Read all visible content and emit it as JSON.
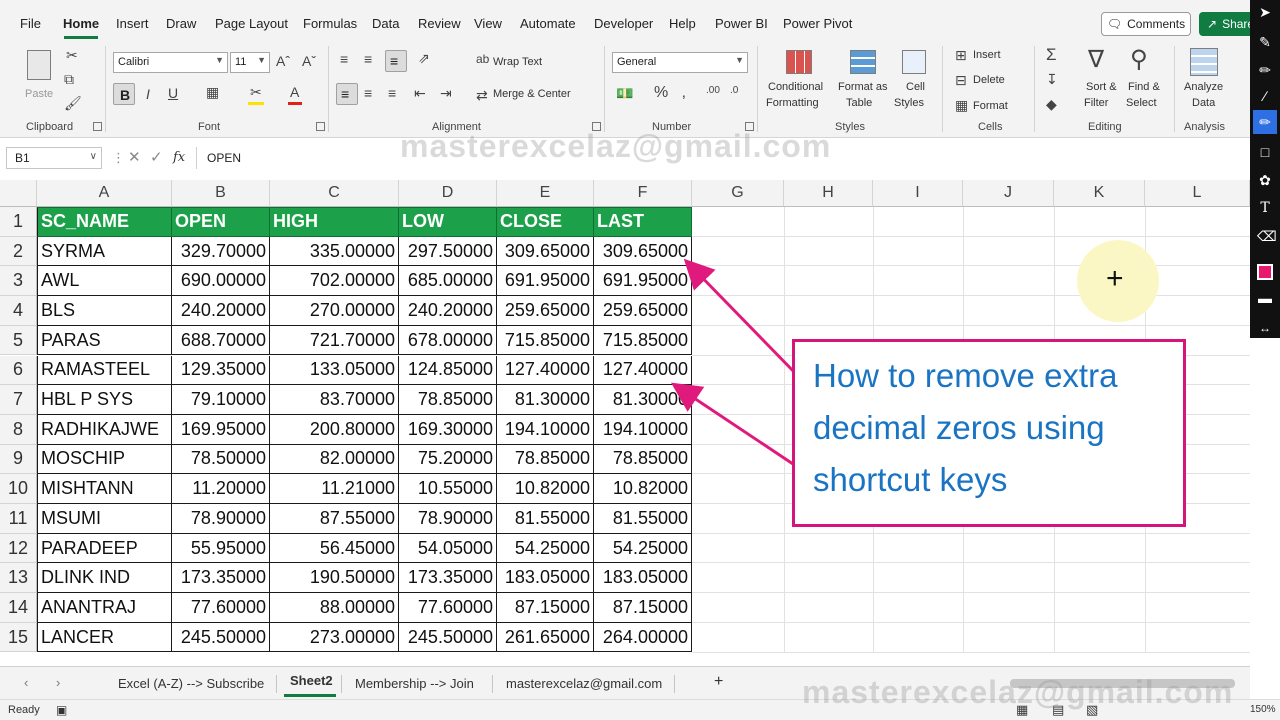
{
  "menu": {
    "items": [
      "File",
      "Home",
      "Insert",
      "Draw",
      "Page Layout",
      "Formulas",
      "Data",
      "Review",
      "View",
      "Automate",
      "Developer",
      "Help",
      "Power BI",
      "Power Pivot"
    ],
    "active": "Home",
    "comments_label": "Comments",
    "share_label": "Share"
  },
  "ribbon": {
    "clipboard": {
      "paste_label": "Paste",
      "group_label": "Clipboard"
    },
    "font": {
      "font_name": "Calibri",
      "font_size": "11",
      "group_label": "Font"
    },
    "alignment": {
      "wrap_text": "Wrap Text",
      "merge_center": "Merge & Center",
      "group_label": "Alignment"
    },
    "number": {
      "format": "General",
      "group_label": "Number"
    },
    "styles": {
      "conditional_1": "Conditional",
      "conditional_2": "Formatting",
      "format_as_1": "Format as",
      "format_as_2": "Table",
      "cell_styles_1": "Cell",
      "cell_styles_2": "Styles",
      "group_label": "Styles"
    },
    "cells": {
      "insert": "Insert",
      "delete": "Delete",
      "format": "Format",
      "group_label": "Cells"
    },
    "editing": {
      "sort_1": "Sort &",
      "sort_2": "Filter",
      "find_1": "Find &",
      "find_2": "Select",
      "group_label": "Editing"
    },
    "analysis": {
      "analyze_1": "Analyze",
      "analyze_2": "Data",
      "group_label": "Analysis"
    }
  },
  "formula_bar": {
    "name_box": "B1",
    "fx": "fx",
    "value": "OPEN"
  },
  "columns": [
    "A",
    "B",
    "C",
    "D",
    "E",
    "F",
    "G",
    "H",
    "I",
    "J",
    "K",
    "L"
  ],
  "rows": [
    "1",
    "2",
    "3",
    "4",
    "5",
    "6",
    "7",
    "8",
    "9",
    "10",
    "11",
    "12",
    "13",
    "14",
    "15"
  ],
  "table": {
    "headers": [
      "SC_NAME",
      "OPEN",
      "HIGH",
      "LOW",
      "CLOSE",
      "LAST"
    ],
    "rows": [
      [
        "SYRMA",
        "329.70000",
        "335.00000",
        "297.50000",
        "309.65000",
        "309.65000"
      ],
      [
        "AWL",
        "690.00000",
        "702.00000",
        "685.00000",
        "691.95000",
        "691.95000"
      ],
      [
        "BLS",
        "240.20000",
        "270.00000",
        "240.20000",
        "259.65000",
        "259.65000"
      ],
      [
        "PARAS",
        "688.70000",
        "721.70000",
        "678.00000",
        "715.85000",
        "715.85000"
      ],
      [
        "RAMASTEEL",
        "129.35000",
        "133.05000",
        "124.85000",
        "127.40000",
        "127.40000"
      ],
      [
        "HBL P SYS",
        "79.10000",
        "83.70000",
        "78.85000",
        "81.30000",
        "81.30000"
      ],
      [
        "RADHIKAJWE",
        "169.95000",
        "200.80000",
        "169.30000",
        "194.10000",
        "194.10000"
      ],
      [
        "MOSCHIP",
        "78.50000",
        "82.00000",
        "75.20000",
        "78.85000",
        "78.85000"
      ],
      [
        "MISHTANN",
        "11.20000",
        "11.21000",
        "10.55000",
        "10.82000",
        "10.82000"
      ],
      [
        "MSUMI",
        "78.90000",
        "87.55000",
        "78.90000",
        "81.55000",
        "81.55000"
      ],
      [
        "PARADEEP",
        "55.95000",
        "56.45000",
        "54.05000",
        "54.25000",
        "54.25000"
      ],
      [
        "DLINK IND",
        "173.35000",
        "190.50000",
        "173.35000",
        "183.05000",
        "183.05000"
      ],
      [
        "ANANTRAJ",
        "77.60000",
        "88.00000",
        "77.60000",
        "87.15000",
        "87.15000"
      ],
      [
        "LANCER",
        "245.50000",
        "273.00000",
        "245.50000",
        "261.65000",
        "264.00000"
      ]
    ]
  },
  "callout": {
    "line1": "How to remove extra",
    "line2": "decimal zeros using",
    "line3": "shortcut keys"
  },
  "sheet_tabs": {
    "tabs": [
      "Excel (A-Z) --> Subscribe",
      "Sheet2",
      "Membership --> Join",
      "masterexcelaz@gmail.com"
    ],
    "active": "Sheet2",
    "add": "+"
  },
  "status": {
    "ready": "Ready",
    "zoom": "150%"
  },
  "watermark": {
    "text": "masterexcelaz@gmail.com"
  },
  "colors": {
    "header_fill": "#1ca04a",
    "accent_green": "#107c41",
    "callout_border": "#d6157a",
    "callout_text": "#1a74c4",
    "arrow": "#e01a7c"
  }
}
